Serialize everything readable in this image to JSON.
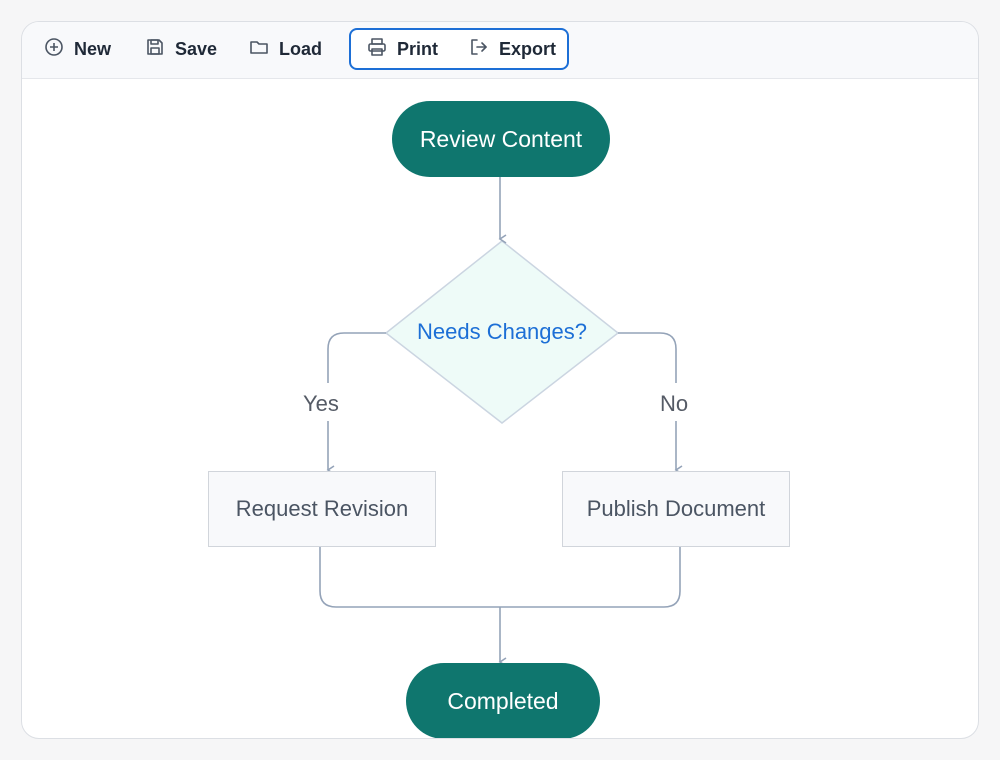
{
  "toolbar": {
    "new_label": "New",
    "save_label": "Save",
    "load_label": "Load",
    "print_label": "Print",
    "export_label": "Export",
    "icons": [
      "plus-circle-icon",
      "save-icon",
      "folder-icon",
      "printer-icon",
      "export-icon"
    ]
  },
  "flowchart": {
    "start_label": "Review Content",
    "decision_label": "Needs Changes?",
    "yes_label": "Yes",
    "no_label": "No",
    "revision_label": "Request Revision",
    "publish_label": "Publish Document",
    "end_label": "Completed"
  },
  "colors": {
    "accent": "#0f766e",
    "decision_text": "#1d6fd6",
    "decision_fill": "#eefbf8",
    "edge": "#94a3b8",
    "toolbar_focus": "#1d6fd6"
  }
}
